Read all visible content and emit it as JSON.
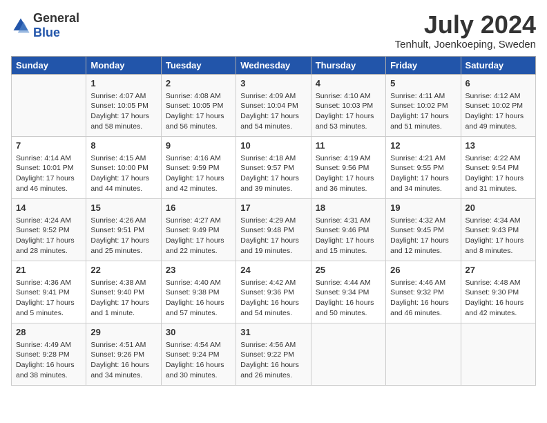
{
  "logo": {
    "general": "General",
    "blue": "Blue"
  },
  "header": {
    "month": "July 2024",
    "location": "Tenhult, Joenkoeping, Sweden"
  },
  "days_of_week": [
    "Sunday",
    "Monday",
    "Tuesday",
    "Wednesday",
    "Thursday",
    "Friday",
    "Saturday"
  ],
  "weeks": [
    [
      {
        "day": "",
        "info": ""
      },
      {
        "day": "1",
        "info": "Sunrise: 4:07 AM\nSunset: 10:05 PM\nDaylight: 17 hours\nand 58 minutes."
      },
      {
        "day": "2",
        "info": "Sunrise: 4:08 AM\nSunset: 10:05 PM\nDaylight: 17 hours\nand 56 minutes."
      },
      {
        "day": "3",
        "info": "Sunrise: 4:09 AM\nSunset: 10:04 PM\nDaylight: 17 hours\nand 54 minutes."
      },
      {
        "day": "4",
        "info": "Sunrise: 4:10 AM\nSunset: 10:03 PM\nDaylight: 17 hours\nand 53 minutes."
      },
      {
        "day": "5",
        "info": "Sunrise: 4:11 AM\nSunset: 10:02 PM\nDaylight: 17 hours\nand 51 minutes."
      },
      {
        "day": "6",
        "info": "Sunrise: 4:12 AM\nSunset: 10:02 PM\nDaylight: 17 hours\nand 49 minutes."
      }
    ],
    [
      {
        "day": "7",
        "info": "Sunrise: 4:14 AM\nSunset: 10:01 PM\nDaylight: 17 hours\nand 46 minutes."
      },
      {
        "day": "8",
        "info": "Sunrise: 4:15 AM\nSunset: 10:00 PM\nDaylight: 17 hours\nand 44 minutes."
      },
      {
        "day": "9",
        "info": "Sunrise: 4:16 AM\nSunset: 9:59 PM\nDaylight: 17 hours\nand 42 minutes."
      },
      {
        "day": "10",
        "info": "Sunrise: 4:18 AM\nSunset: 9:57 PM\nDaylight: 17 hours\nand 39 minutes."
      },
      {
        "day": "11",
        "info": "Sunrise: 4:19 AM\nSunset: 9:56 PM\nDaylight: 17 hours\nand 36 minutes."
      },
      {
        "day": "12",
        "info": "Sunrise: 4:21 AM\nSunset: 9:55 PM\nDaylight: 17 hours\nand 34 minutes."
      },
      {
        "day": "13",
        "info": "Sunrise: 4:22 AM\nSunset: 9:54 PM\nDaylight: 17 hours\nand 31 minutes."
      }
    ],
    [
      {
        "day": "14",
        "info": "Sunrise: 4:24 AM\nSunset: 9:52 PM\nDaylight: 17 hours\nand 28 minutes."
      },
      {
        "day": "15",
        "info": "Sunrise: 4:26 AM\nSunset: 9:51 PM\nDaylight: 17 hours\nand 25 minutes."
      },
      {
        "day": "16",
        "info": "Sunrise: 4:27 AM\nSunset: 9:49 PM\nDaylight: 17 hours\nand 22 minutes."
      },
      {
        "day": "17",
        "info": "Sunrise: 4:29 AM\nSunset: 9:48 PM\nDaylight: 17 hours\nand 19 minutes."
      },
      {
        "day": "18",
        "info": "Sunrise: 4:31 AM\nSunset: 9:46 PM\nDaylight: 17 hours\nand 15 minutes."
      },
      {
        "day": "19",
        "info": "Sunrise: 4:32 AM\nSunset: 9:45 PM\nDaylight: 17 hours\nand 12 minutes."
      },
      {
        "day": "20",
        "info": "Sunrise: 4:34 AM\nSunset: 9:43 PM\nDaylight: 17 hours\nand 8 minutes."
      }
    ],
    [
      {
        "day": "21",
        "info": "Sunrise: 4:36 AM\nSunset: 9:41 PM\nDaylight: 17 hours\nand 5 minutes."
      },
      {
        "day": "22",
        "info": "Sunrise: 4:38 AM\nSunset: 9:40 PM\nDaylight: 17 hours\nand 1 minute."
      },
      {
        "day": "23",
        "info": "Sunrise: 4:40 AM\nSunset: 9:38 PM\nDaylight: 16 hours\nand 57 minutes."
      },
      {
        "day": "24",
        "info": "Sunrise: 4:42 AM\nSunset: 9:36 PM\nDaylight: 16 hours\nand 54 minutes."
      },
      {
        "day": "25",
        "info": "Sunrise: 4:44 AM\nSunset: 9:34 PM\nDaylight: 16 hours\nand 50 minutes."
      },
      {
        "day": "26",
        "info": "Sunrise: 4:46 AM\nSunset: 9:32 PM\nDaylight: 16 hours\nand 46 minutes."
      },
      {
        "day": "27",
        "info": "Sunrise: 4:48 AM\nSunset: 9:30 PM\nDaylight: 16 hours\nand 42 minutes."
      }
    ],
    [
      {
        "day": "28",
        "info": "Sunrise: 4:49 AM\nSunset: 9:28 PM\nDaylight: 16 hours\nand 38 minutes."
      },
      {
        "day": "29",
        "info": "Sunrise: 4:51 AM\nSunset: 9:26 PM\nDaylight: 16 hours\nand 34 minutes."
      },
      {
        "day": "30",
        "info": "Sunrise: 4:54 AM\nSunset: 9:24 PM\nDaylight: 16 hours\nand 30 minutes."
      },
      {
        "day": "31",
        "info": "Sunrise: 4:56 AM\nSunset: 9:22 PM\nDaylight: 16 hours\nand 26 minutes."
      },
      {
        "day": "",
        "info": ""
      },
      {
        "day": "",
        "info": ""
      },
      {
        "day": "",
        "info": ""
      }
    ]
  ]
}
